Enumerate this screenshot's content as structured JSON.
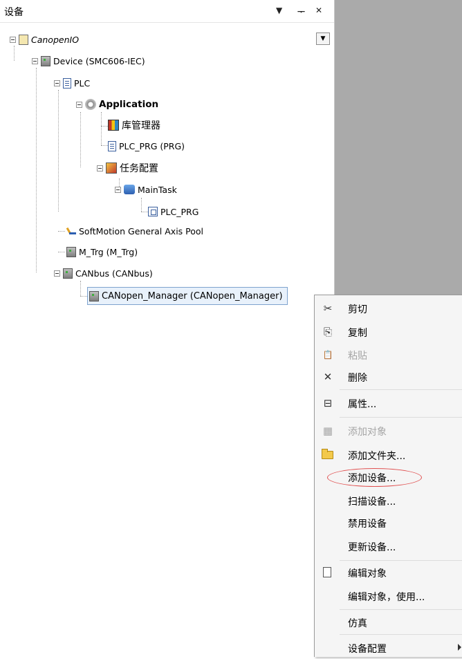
{
  "panel": {
    "title": "设备",
    "dropdown_arrow": "▼",
    "pin": "ᅮ",
    "close": "✕"
  },
  "tree": {
    "project": "CanopenIO",
    "device": "Device (SMC606-IEC)",
    "plc": "PLC",
    "application": "Application",
    "library_manager": "库管理器",
    "plc_prg": "PLC_PRG (PRG)",
    "task_config": "任务配置",
    "main_task": "MainTask",
    "plc_prg_call": "PLC_PRG",
    "axis_pool": "SoftMotion General Axis Pool",
    "m_trg": "M_Trg (M_Trg)",
    "canbus": "CANbus (CANbus)",
    "canopen_manager": "CANopen_Manager (CANopen_Manager)"
  },
  "context_menu": {
    "cut": "剪切",
    "copy": "复制",
    "paste": "粘贴",
    "delete": "删除",
    "properties": "属性...",
    "add_object": "添加对象",
    "add_folder": "添加文件夹...",
    "add_device": "添加设备...",
    "scan_devices": "扫描设备...",
    "disable_device": "禁用设备",
    "update_device": "更新设备...",
    "edit_object": "编辑对象",
    "edit_object_with": "编辑对象，使用...",
    "simulation": "仿真",
    "device_config": "设备配置"
  },
  "icons": {
    "cut": "✂",
    "copy": "⎘",
    "paste": "📋",
    "delete": "✕",
    "properties": "⊟",
    "add_object": "▦"
  }
}
